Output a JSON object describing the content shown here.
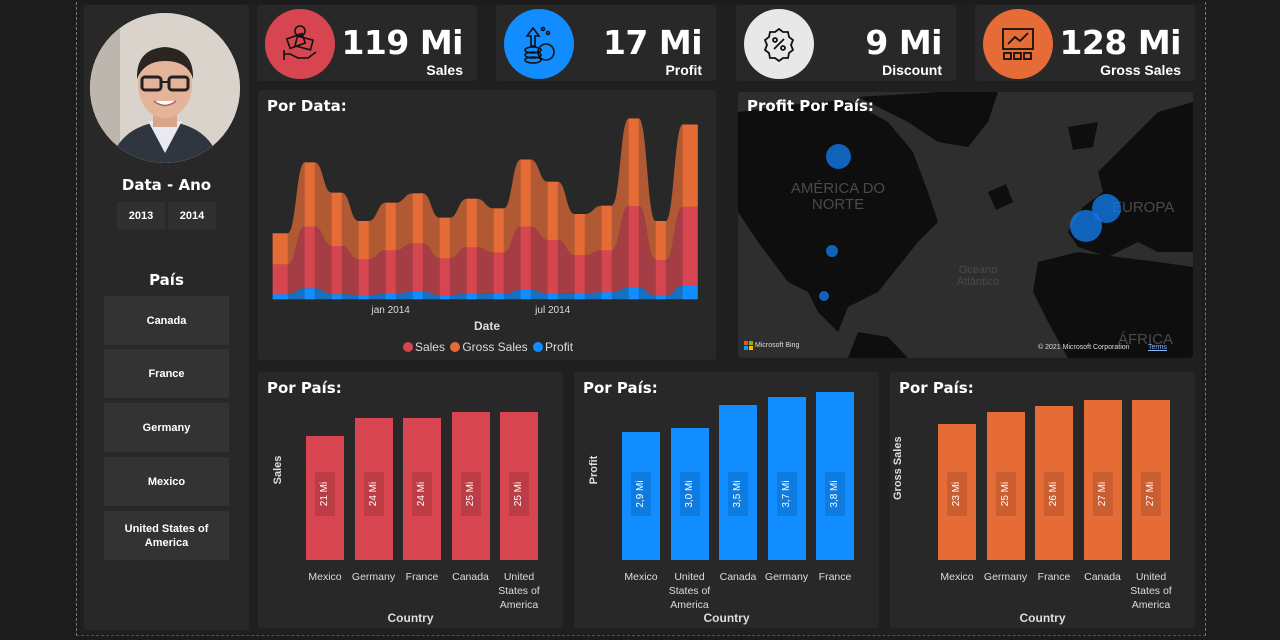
{
  "colors": {
    "sales": "#d64550",
    "profit": "#118dff",
    "discount": "#e8e8e8",
    "gross": "#e66c37",
    "panel": "#282828"
  },
  "sidebar": {
    "year_title": "Data - Ano",
    "years": [
      "2013",
      "2014"
    ],
    "country_title": "País",
    "countries": [
      "Canada",
      "France",
      "Germany",
      "Mexico",
      "United States of America"
    ]
  },
  "kpis": [
    {
      "value": "119 Mi",
      "label": "Sales",
      "icon": "money-hand-icon"
    },
    {
      "value": "17 Mi",
      "label": "Profit",
      "icon": "coins-growth-icon"
    },
    {
      "value": "9 Mi",
      "label": "Discount",
      "icon": "discount-badge-icon"
    },
    {
      "value": "128 Mi",
      "label": "Gross Sales",
      "icon": "chart-growth-icon"
    }
  ],
  "map": {
    "title": "Profit Por País:",
    "labels": {
      "north_america": "AMÉRICA DO NORTE",
      "ocean": "Oceano Atlântico",
      "europe": "EUROPA",
      "africa": "ÁFRICA"
    },
    "attribution": {
      "logo": "Microsoft Bing",
      "copyright": "© 2021 Microsoft Corporation",
      "terms": "Terms"
    },
    "bubbles": [
      {
        "country": "Canada",
        "profit_mi": 3.5
      },
      {
        "country": "United States of America",
        "profit_mi": 3.0
      },
      {
        "country": "Mexico",
        "profit_mi": 2.9
      },
      {
        "country": "France",
        "profit_mi": 3.8
      },
      {
        "country": "Germany",
        "profit_mi": 3.7
      }
    ]
  },
  "chart_data": [
    {
      "type": "area",
      "stacked": true,
      "title": "Por Data:",
      "xlabel": "Date",
      "ylabel": "",
      "legend": "bottom",
      "x": [
        "2013-09",
        "2013-10",
        "2013-11",
        "2013-12",
        "2014-01",
        "2014-02",
        "2014-03",
        "2014-04",
        "2014-05",
        "2014-06",
        "2014-07",
        "2014-08",
        "2014-09",
        "2014-10",
        "2014-11",
        "2014-12"
      ],
      "xticks": [
        {
          "at": "2014-01",
          "label": "jan 2014"
        },
        {
          "at": "2014-07",
          "label": "jul 2014"
        }
      ],
      "ylim": [
        0,
        29.5
      ],
      "series": [
        {
          "name": "Profit",
          "color": "#118dff",
          "values": [
            0.78,
            1.71,
            0.78,
            0.67,
            0.83,
            1.19,
            0.62,
            0.93,
            0.83,
            1.45,
            0.93,
            0.83,
            1.09,
            1.81,
            0.57,
            2.07
          ]
        },
        {
          "name": "Sales",
          "color": "#d64550",
          "values": [
            4.65,
            9.56,
            7.5,
            5.53,
            6.77,
            7.5,
            5.74,
            7.13,
            6.41,
            9.82,
            8.27,
            6.0,
            6.51,
            12.67,
            5.53,
            12.3
          ]
        },
        {
          "name": "Gross Sales",
          "color": "#e66c37",
          "values": [
            4.81,
            9.98,
            8.27,
            5.95,
            7.39,
            7.76,
            6.31,
            7.55,
            6.88,
            10.44,
            9.05,
            6.41,
            6.93,
            13.6,
            6.05,
            12.77
          ]
        }
      ],
      "legend_order": [
        "Sales",
        "Gross Sales",
        "Profit"
      ]
    },
    {
      "type": "bar",
      "title": "Por País:",
      "xlabel": "Country",
      "ylabel": "Sales",
      "color": "#d64550",
      "ylim": [
        0,
        28.7
      ],
      "categories": [
        "Mexico",
        "Germany",
        "France",
        "Canada",
        "United States of America"
      ],
      "values": [
        21,
        24,
        24,
        25,
        25
      ],
      "data_labels": [
        "21 Mi",
        "24 Mi",
        "24 Mi",
        "25 Mi",
        "25 Mi"
      ]
    },
    {
      "type": "bar",
      "title": "Por País:",
      "xlabel": "Country",
      "ylabel": "Profit",
      "color": "#118dff",
      "ylim": [
        0,
        3.85
      ],
      "categories": [
        "Mexico",
        "United States of America",
        "Canada",
        "Germany",
        "France"
      ],
      "values": [
        2.9,
        3.0,
        3.5,
        3.7,
        3.8
      ],
      "data_labels": [
        "2,9 Mi",
        "3,0 Mi",
        "3,5 Mi",
        "3,7 Mi",
        "3,8 Mi"
      ]
    },
    {
      "type": "bar",
      "title": "Por País:",
      "xlabel": "Country",
      "ylabel": "Gross Sales",
      "color": "#e66c37",
      "ylim": [
        0,
        28.7
      ],
      "categories": [
        "Mexico",
        "Germany",
        "France",
        "Canada",
        "United States of America"
      ],
      "values": [
        23,
        25,
        26,
        27,
        27
      ],
      "data_labels": [
        "23 Mi",
        "25 Mi",
        "26 Mi",
        "27 Mi",
        "27 Mi"
      ]
    }
  ]
}
